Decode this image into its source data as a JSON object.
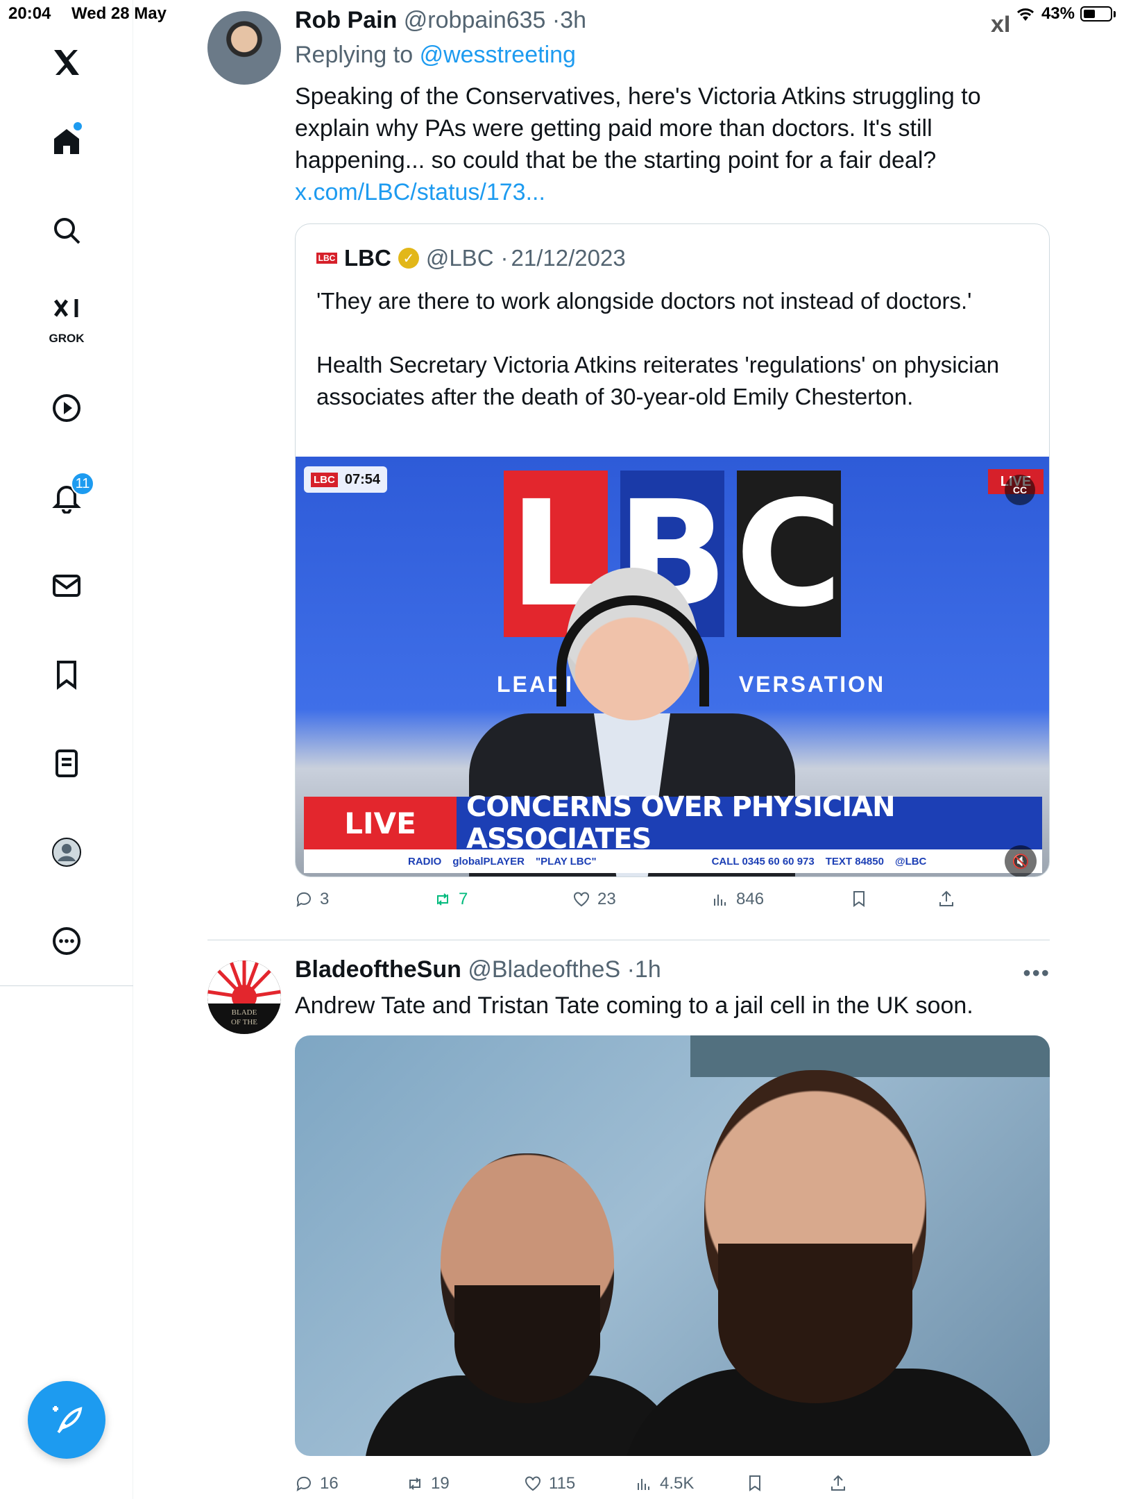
{
  "status_bar": {
    "time": "20:04",
    "date": "Wed 28 May",
    "battery": "43%",
    "corner_mark": "xI"
  },
  "sidebar": {
    "items": [
      {
        "icon": "x-logo-icon"
      },
      {
        "icon": "home-icon",
        "has_dot": true
      },
      {
        "icon": "search-icon"
      },
      {
        "icon": "grok-icon",
        "label": "GROK"
      },
      {
        "icon": "video-play-icon"
      },
      {
        "icon": "notifications-icon",
        "badge": "11"
      },
      {
        "icon": "messages-icon"
      },
      {
        "icon": "bookmarks-icon"
      },
      {
        "icon": "lists-icon"
      },
      {
        "icon": "profile-icon"
      },
      {
        "icon": "more-icon"
      }
    ],
    "compose_icon": "compose-post-icon"
  },
  "tweets": [
    {
      "name": "Rob Pain",
      "handle": "@robpain635",
      "time": "3h",
      "replying_prefix": "Replying to",
      "replying_to": "@wesstreeting",
      "text": "Speaking of the Conservatives, here's Victoria Atkins struggling to explain why PAs were getting paid more than doctors. It's still happening... so could that be the starting point for a fair deal?",
      "link": "x.com/LBC/status/173...",
      "quote": {
        "name": "LBC",
        "handle": "@LBC",
        "date": "21/12/2023",
        "text_1": "'They are there to work alongside doctors not instead of doctors.'",
        "text_2": "Health Secretary Victoria Atkins reiterates 'regulations' on physician associates after the death of 30-year-old Emily Chesterton.",
        "video": {
          "duration": "07:54",
          "timer_chip": "LBC",
          "logo_letters": [
            "L",
            "B",
            "C"
          ],
          "tagline": "LEADI                    VERSATION",
          "live_corner": "LIVE",
          "cc": "CC",
          "lower_third_live": "LIVE",
          "lower_third_headline": "CONCERNS OVER PHYSICIAN ASSOCIATES",
          "ticker_items": [
            "RADIO",
            "globalPLAYER",
            "\"PLAY LBC\"",
            "CALL 0345 60 60 973",
            "TEXT 84850",
            "@LBC"
          ]
        }
      },
      "actions": {
        "replies": "3",
        "reposts": "7",
        "likes": "23",
        "views": "846"
      }
    },
    {
      "name": "BladeoftheSun",
      "handle": "@BladeoftheS",
      "time": "1h",
      "text": "Andrew Tate and Tristan Tate coming to a jail cell in the UK soon.",
      "avatar_text": "BLADE OF THE",
      "actions": {
        "replies": "16",
        "reposts": "19",
        "likes": "115",
        "views": "4.5K"
      }
    }
  ],
  "colors": {
    "accent": "#1d9bf0",
    "text": "#0f1419",
    "muted": "#536471",
    "repost_green": "#00ba7c",
    "lbc_red": "#e3262d",
    "lbc_blue": "#1c3fb5"
  }
}
